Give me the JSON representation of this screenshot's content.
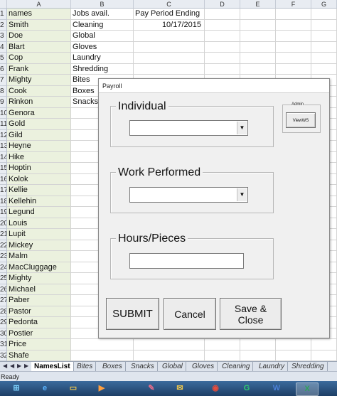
{
  "sheet": {
    "columns": [
      "A",
      "B",
      "C",
      "D",
      "E",
      "F",
      "G"
    ],
    "headers_row": {
      "a": "names",
      "b": "Jobs avail.",
      "c": "Pay Period Ending"
    },
    "row_numbers": [
      "1",
      "2",
      "3",
      "4",
      "5",
      "6",
      "7",
      "8",
      "9",
      "10",
      "11",
      "12",
      "13",
      "14",
      "15",
      "16",
      "17",
      "18",
      "19",
      "20",
      "21",
      "22",
      "23",
      "24",
      "25",
      "26",
      "27",
      "28",
      "29",
      "30",
      "31",
      "32"
    ],
    "names": [
      "Smith",
      "Doe",
      "Blart",
      "Cop",
      "Frank",
      "Mighty",
      "Cook",
      "Rinkon",
      "Genora",
      "Gold",
      "Gild",
      "Heyne",
      "Hike",
      "Hoptin",
      "Kolok",
      "Kellie",
      "Kellehin",
      "Legund",
      "Louis",
      "Lupit",
      "Mickey",
      "Malm",
      "MacCluggage",
      "Mighty",
      "Michael",
      "Paber",
      "Pastor",
      "Pedonta",
      "Postier",
      "Price",
      "Shafe"
    ],
    "jobs": [
      "Cleaning",
      "Global",
      "Gloves",
      "Laundry",
      "Shredding",
      "Bites",
      "Boxes",
      "Snacks"
    ],
    "pay_period_date": "10/17/2015"
  },
  "dialog": {
    "title": "Payroll",
    "individual_label": "Individual",
    "work_label": "Work Performed",
    "hours_label": "Hours/Pieces",
    "individual_value": "",
    "work_value": "",
    "hours_value": "",
    "admin_label": "Admin",
    "viewws_label": "ViewWS",
    "submit_label": "SUBMIT",
    "cancel_label": "Cancel",
    "save_close_label": "Save & Close"
  },
  "tabs": [
    "NamesList",
    "Bites",
    "Boxes",
    "Snacks",
    "Global",
    "Gloves",
    "Cleaning",
    "Laundry",
    "Shredding"
  ],
  "active_tab": "NamesList",
  "status": "Ready",
  "taskbar_icons": [
    "windows-start-icon",
    "internet-explorer-icon",
    "file-explorer-icon",
    "media-player-icon",
    "paint-icon",
    "outlook-icon",
    "chrome-icon",
    "green-app-icon",
    "word-icon",
    "excel-icon"
  ],
  "colors": {
    "names_column": "#ebf1de",
    "dialog_bg": "#f0f0f0",
    "taskbar": "#2a5282"
  }
}
